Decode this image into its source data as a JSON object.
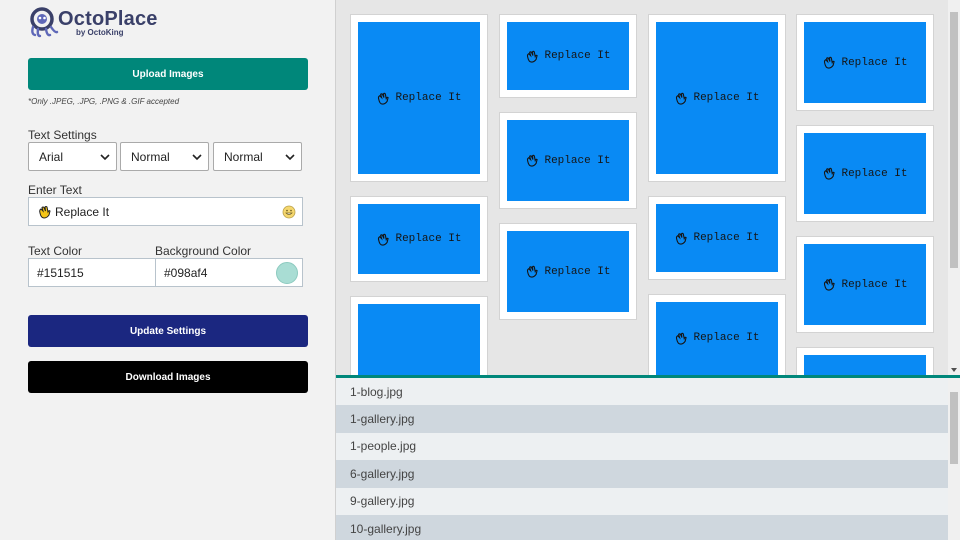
{
  "app": {
    "logo_text": "OctoPlace",
    "logo_sub": "by OctoKing"
  },
  "sidebar": {
    "upload_label": "Upload Images",
    "upload_note": "*Only .JPEG, .JPG, .PNG & .GIF accepted",
    "text_settings_label": "Text Settings",
    "font_family": "Arial",
    "font_weight": "Normal",
    "font_style": "Normal",
    "enter_text_label": "Enter Text",
    "text_value": "Replace It",
    "text_color_label": "Text Color",
    "text_color_value": "#151515",
    "bg_color_label": "Background Color",
    "bg_color_value": "#098af4",
    "update_label": "Update Settings",
    "download_label": "Download Images"
  },
  "gallery": {
    "card_text": "Replace It",
    "card_color": "#098af4",
    "card_text_color": "#151515"
  },
  "files": [
    "1-blog.jpg",
    "1-gallery.jpg",
    "1-people.jpg",
    "6-gallery.jpg",
    "9-gallery.jpg",
    "10-gallery.jpg"
  ],
  "colors": {
    "upload_button": "#00877a",
    "update_button": "#1b2780",
    "download_button": "#000000",
    "accent": "#00877a"
  },
  "icons": {
    "card_icon": "waving-hand-icon",
    "emoji_picker": "smiley-icon",
    "select_arrow": "chevron-down-icon"
  }
}
